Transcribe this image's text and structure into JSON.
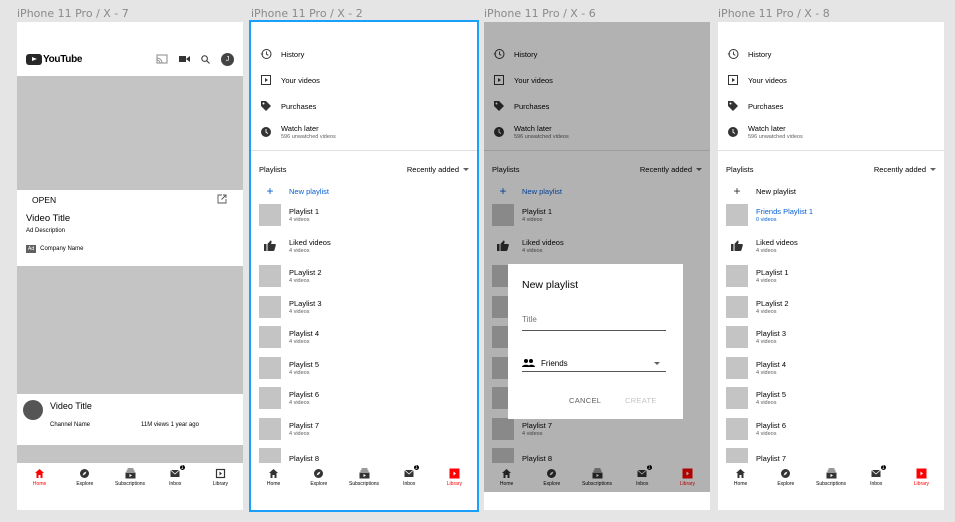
{
  "frames": [
    {
      "label": "iPhone 11 Pro / X - 7"
    },
    {
      "label": "iPhone 11 Pro / X - 2"
    },
    {
      "label": "iPhone 11 Pro / X - 6"
    },
    {
      "label": "iPhone 11 Pro / X - 8"
    }
  ],
  "home": {
    "logo": "YouTube",
    "avatar_letter": "J",
    "ad": {
      "open": "OPEN",
      "title": "Video Title",
      "description": "Ad Description",
      "tag": "Ad",
      "company": "Company Name"
    },
    "video": {
      "title": "Video Title",
      "channel": "Channel Name",
      "meta": "11M views   1 year ago"
    }
  },
  "library": {
    "history": "History",
    "your_videos": "Your videos",
    "purchases": "Purchases",
    "watch_later": "Watch later",
    "watch_later_sub": "596 unwatched videos",
    "playlists_title": "Playlists",
    "sort": "Recently added",
    "new_playlist": "New playlist",
    "playlists": [
      {
        "name": "Playlist 1",
        "count": "4 videos"
      },
      {
        "name": "Liked videos",
        "count": "4 videos"
      },
      {
        "name": "PLaylist 2",
        "count": "4 videos"
      },
      {
        "name": "PLaylist 3",
        "count": "4 videos"
      },
      {
        "name": "Playlist 4",
        "count": "4 videos"
      },
      {
        "name": "Playlist 5",
        "count": "4 videos"
      },
      {
        "name": "Playlist 6",
        "count": "4 videos"
      },
      {
        "name": "Playlist 7",
        "count": "4 videos"
      },
      {
        "name": "Playlist 8",
        "count": ""
      }
    ],
    "playlists_after": [
      {
        "name": "Friends Playlist 1",
        "count": "0 videos"
      },
      {
        "name": "Liked videos",
        "count": "4 videos"
      },
      {
        "name": "PLaylist 1",
        "count": "4 videos"
      },
      {
        "name": "PLaylist 2",
        "count": "4 videos"
      },
      {
        "name": "Playlist 3",
        "count": "4 videos"
      },
      {
        "name": "Playlist 4",
        "count": "4 videos"
      },
      {
        "name": "Playlist 5",
        "count": "4 videos"
      },
      {
        "name": "Playlist 6",
        "count": "4 videos"
      },
      {
        "name": "Playlist 7",
        "count": ""
      }
    ]
  },
  "dialog": {
    "title": "New playlist",
    "title_placeholder": "Title",
    "privacy": "Friends",
    "cancel": "CANCEL",
    "create": "CREATE"
  },
  "nav": {
    "home": "Home",
    "explore": "Explore",
    "subscriptions": "Subscriptions",
    "inbox": "Inbox",
    "library": "Library",
    "inbox_badge": "1"
  },
  "colors": {
    "accent": "#ff0000",
    "link": "#065fd4",
    "selection": "#18a0fb",
    "placeholder": "#c4c4c4"
  }
}
